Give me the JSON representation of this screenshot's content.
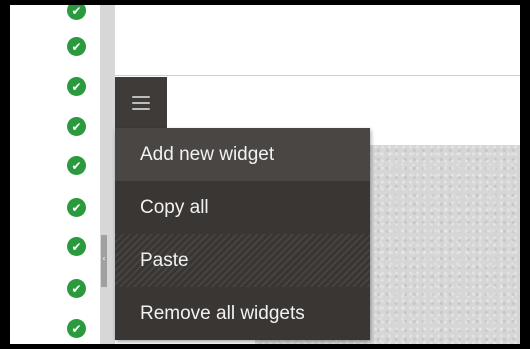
{
  "status_column": {
    "icon": "check-circle-icon",
    "color": "#2b9a3e",
    "rows": [
      {
        "label": "✔"
      },
      {
        "label": "✔"
      },
      {
        "label": "✔"
      },
      {
        "label": "✔"
      },
      {
        "label": "✔"
      },
      {
        "label": "✔"
      },
      {
        "label": "✔"
      },
      {
        "label": "✔"
      },
      {
        "label": "✔"
      },
      {
        "label": "✔"
      }
    ]
  },
  "splitter": {
    "arrow": "‹"
  },
  "widget_menu": {
    "icon": "hamburger-icon",
    "items": [
      {
        "label": "Add new widget"
      },
      {
        "label": "Copy all"
      },
      {
        "label": "Paste"
      },
      {
        "label": "Remove all widgets"
      }
    ]
  },
  "colors": {
    "menu_background": "#3c3836",
    "menu_text": "#f2f2f2",
    "check_green": "#2b9a3e"
  }
}
